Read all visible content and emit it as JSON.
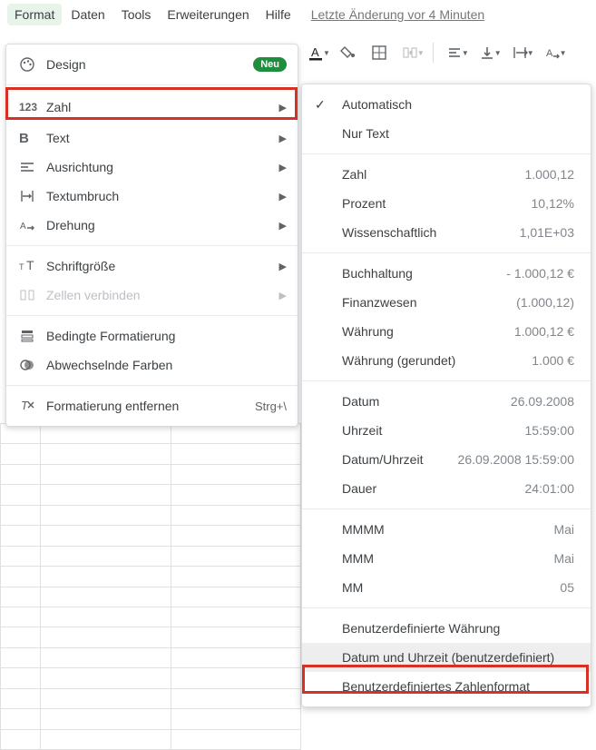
{
  "menubar": {
    "format": "Format",
    "daten": "Daten",
    "tools": "Tools",
    "erweiterungen": "Erweiterungen",
    "hilfe": "Hilfe",
    "last_change": "Letzte Änderung vor 4 Minuten"
  },
  "format_menu": {
    "design": "Design",
    "neu_badge": "Neu",
    "zahl": "Zahl",
    "text": "Text",
    "ausrichtung": "Ausrichtung",
    "textumbruch": "Textumbruch",
    "drehung": "Drehung",
    "schriftgroesse": "Schriftgröße",
    "zellen_verbinden": "Zellen verbinden",
    "bedingte": "Bedingte Formatierung",
    "abwechselnde": "Abwechselnde Farben",
    "entfernen": "Formatierung entfernen",
    "entfernen_shortcut": "Strg+\\"
  },
  "submenu": {
    "automatisch": "Automatisch",
    "nur_text": "Nur Text",
    "zahl": "Zahl",
    "zahl_val": "1.000,12",
    "prozent": "Prozent",
    "prozent_val": "10,12%",
    "wissen": "Wissenschaftlich",
    "wissen_val": "1,01E+03",
    "buchhaltung": "Buchhaltung",
    "buchhaltung_val": "- 1.000,12 €",
    "finanz": "Finanzwesen",
    "finanz_val": "(1.000,12)",
    "waehrung": "Währung",
    "waehrung_val": "1.000,12 €",
    "waehrung_r": "Währung (gerundet)",
    "waehrung_r_val": "1.000 €",
    "datum": "Datum",
    "datum_val": "26.09.2008",
    "uhrzeit": "Uhrzeit",
    "uhrzeit_val": "15:59:00",
    "datumuhr": "Datum/Uhrzeit",
    "datumuhr_val": "26.09.2008 15:59:00",
    "dauer": "Dauer",
    "dauer_val": "24:01:00",
    "mmmm": "MMMM",
    "mmmm_val": "Mai",
    "mmm": "MMM",
    "mmm_val": "Mai",
    "mm": "MM",
    "mm_val": "05",
    "benutzer_w": "Benutzerdefinierte Währung",
    "benutzer_du": "Datum und Uhrzeit (benutzerdefiniert)",
    "benutzer_z": "Benutzerdefiniertes Zahlenformat"
  }
}
